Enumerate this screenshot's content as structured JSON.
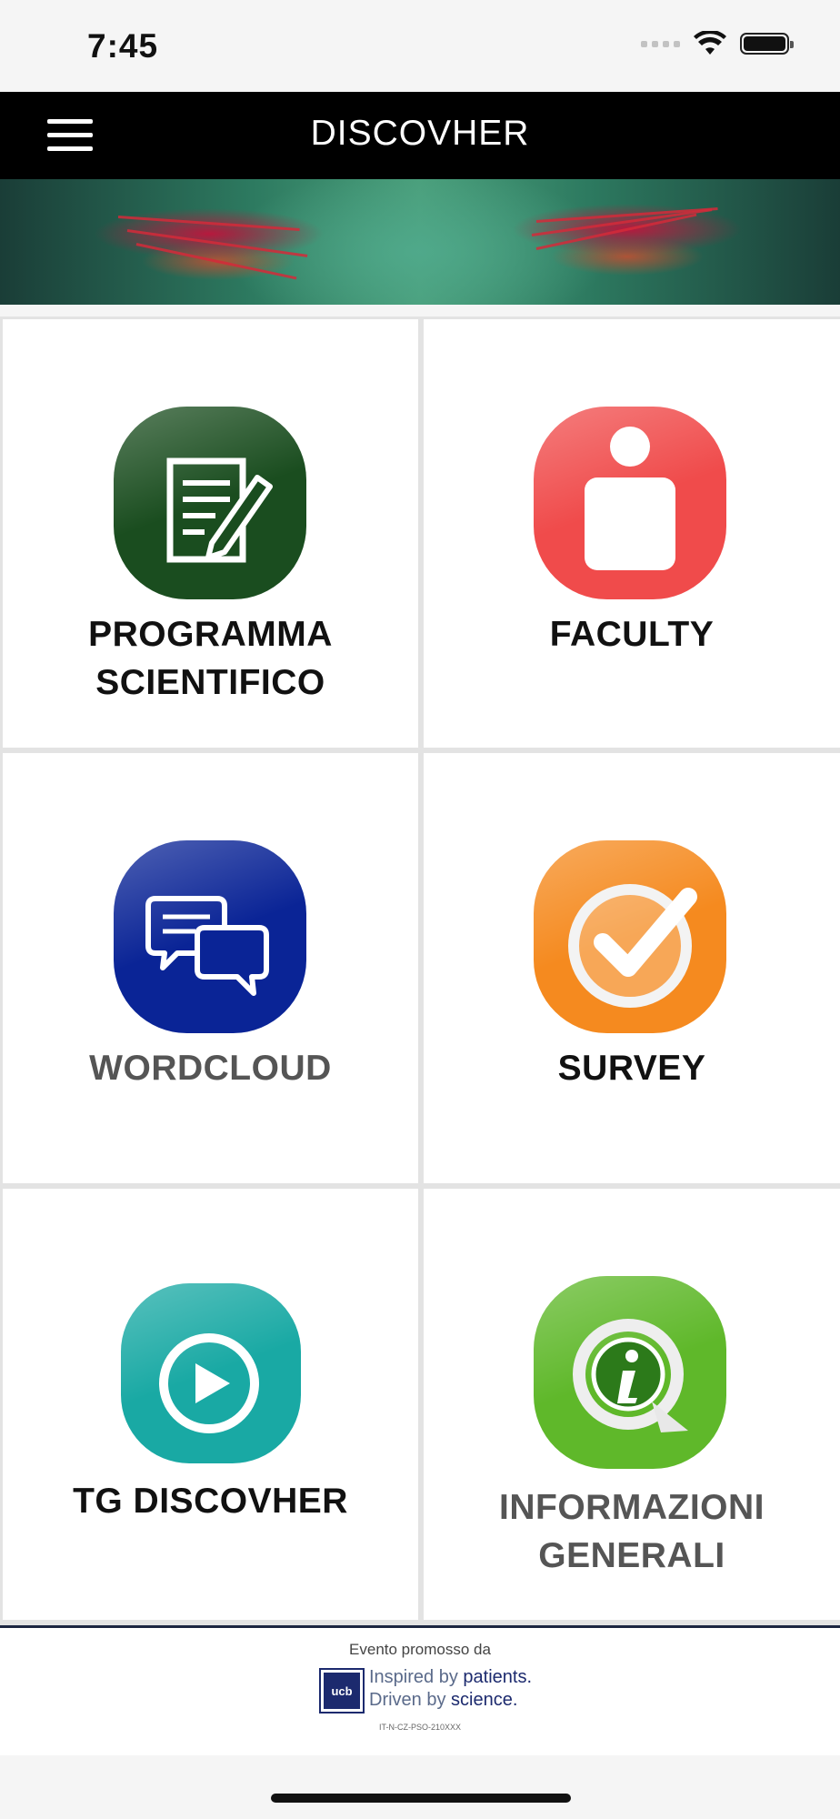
{
  "status_bar": {
    "time": "7:45"
  },
  "navbar": {
    "title": "DISCOVHER",
    "menu_icon": "hamburger-menu-icon"
  },
  "tiles": [
    {
      "line1": "PROGRAMMA",
      "line2": "SCIENTIFICO",
      "icon": "document-edit-icon",
      "color": "#1a4d1f",
      "label_color": "#111111"
    },
    {
      "line1": "FACULTY",
      "line2": "",
      "icon": "person-icon",
      "color": "#f04b4b",
      "label_color": "#111111"
    },
    {
      "line1": "WORDCLOUD",
      "line2": "",
      "icon": "chat-bubbles-icon",
      "color": "#0a2496",
      "label_color": "#555555"
    },
    {
      "line1": "SURVEY",
      "line2": "",
      "icon": "checkmark-icon",
      "color": "#f58a1f",
      "label_color": "#111111"
    },
    {
      "line1": "TG DISCOVHER",
      "line2": "",
      "icon": "play-icon",
      "color": "#19a9a4",
      "label_color": "#111111"
    },
    {
      "line1": "INFORMAZIONI",
      "line2": "GENERALI",
      "icon": "info-icon",
      "color": "#5fb82a",
      "label_color": "#555555"
    }
  ],
  "footer": {
    "promo": "Evento promosso da",
    "logo": "ucb",
    "tagline_1a": "Inspired by ",
    "tagline_1b": "patients.",
    "tagline_2a": "Driven by ",
    "tagline_2b": "science.",
    "code": "IT-N-CZ-PSO-210XXX"
  }
}
